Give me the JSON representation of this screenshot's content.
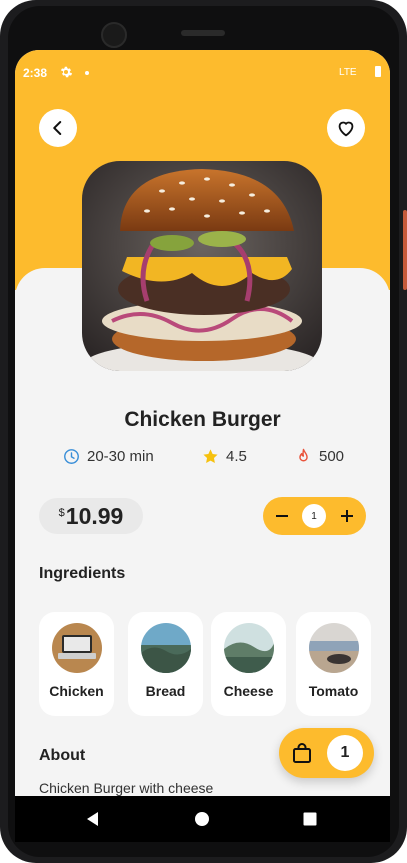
{
  "status_bar": {
    "time": "2:38",
    "network": "LTE"
  },
  "header": {
    "back_icon": "back-arrow-icon",
    "favorite_icon": "heart-outline-icon"
  },
  "product": {
    "name": "Chicken Burger",
    "image": "burger-photo",
    "prep_time": "20-30 min",
    "rating": "4.5",
    "calories": "500",
    "currency": "$",
    "price": "10.99",
    "quantity": "1"
  },
  "ingredients": {
    "title": "Ingredients",
    "items": [
      {
        "label": "Chicken"
      },
      {
        "label": "Bread"
      },
      {
        "label": "Cheese"
      },
      {
        "label": "Tomato"
      }
    ]
  },
  "about": {
    "title": "About",
    "text": "Chicken Burger with cheese"
  },
  "cart": {
    "count": "1"
  },
  "colors": {
    "accent": "#fdbb2d",
    "background": "#f4f4f4",
    "clock_icon": "#3a8fd8",
    "star": "#f6c10e",
    "flame": "#e9533b"
  }
}
